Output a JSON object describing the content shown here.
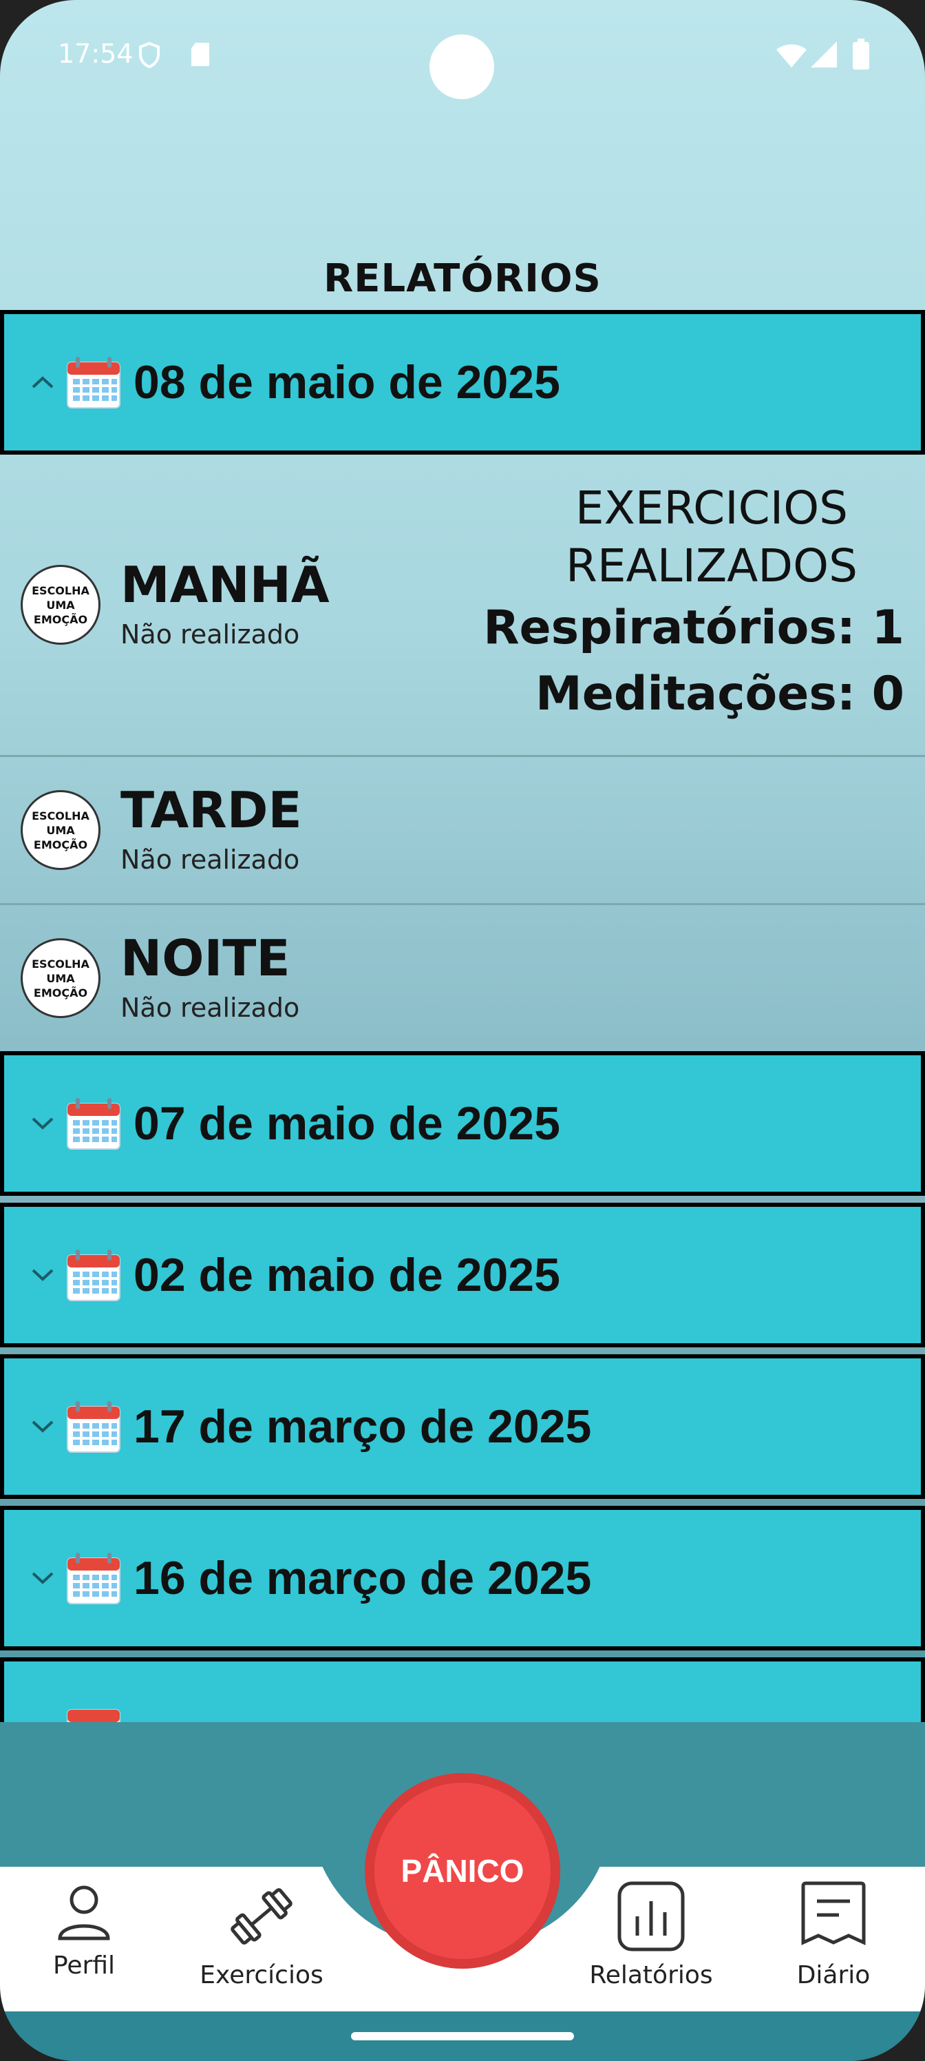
{
  "status_bar": {
    "time": "17:54"
  },
  "header": {
    "title": "RELATÓRIOS"
  },
  "days": [
    {
      "date": "08 de maio de 2025",
      "expanded": true
    },
    {
      "date": "07 de maio de 2025",
      "expanded": false
    },
    {
      "date": "02 de maio de 2025",
      "expanded": false
    },
    {
      "date": "17 de março de 2025",
      "expanded": false
    },
    {
      "date": "16 de março de 2025",
      "expanded": false
    },
    {
      "date": "",
      "expanded": false
    }
  ],
  "expanded_day": {
    "periods": [
      {
        "name": "MANHÃ",
        "status": "Não realizado",
        "badge": "ESCOLHA UMA EMOÇÃO"
      },
      {
        "name": "TARDE",
        "status": "Não realizado",
        "badge": "ESCOLHA UMA EMOÇÃO"
      },
      {
        "name": "NOITE",
        "status": "Não realizado",
        "badge": "ESCOLHA UMA EMOÇÃO"
      }
    ],
    "exercises": {
      "title_line1": "EXERCICIOS",
      "title_line2": "REALIZADOS",
      "breathing": "Respiratórios: 1",
      "meditations": "Meditações: 0"
    }
  },
  "badge_lines": [
    "ESCOLHA",
    "UMA",
    "EMOÇÃO"
  ],
  "nav": {
    "profile": "Perfil",
    "exercises": "Exercícios",
    "panic": "PÂNICO",
    "reports": "Relatórios",
    "diary": "Diário"
  },
  "colors": {
    "header_bg": "#33c6d4",
    "panic": "#f04848",
    "nav_teal": "#3e929e"
  }
}
